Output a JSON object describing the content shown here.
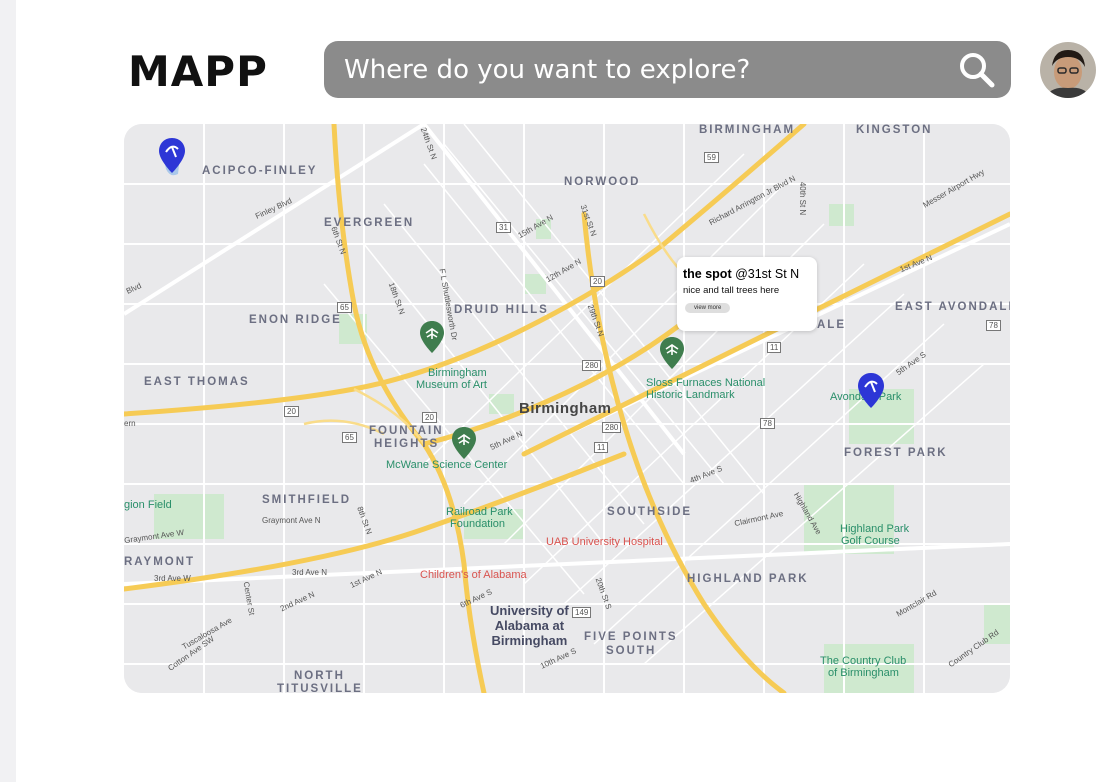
{
  "app": {
    "logo": "MAPP",
    "search": {
      "placeholder": "Where do you want to explore?"
    }
  },
  "map": {
    "city_label": "Birmingham",
    "neighborhoods": [
      "BIRMINGHAM",
      "KINGSTON",
      "ACIPCO-FINLEY",
      "NORWOOD",
      "EVERGREEN",
      "DRUID HILLS",
      "EAST AVONDALE",
      "ENON RIDGE",
      "EAST THOMAS",
      "FOUNTAIN",
      "HEIGHTS",
      "FOREST PARK",
      "SMITHFIELD",
      "SOUTHSIDE",
      "RAYMONT",
      "HIGHLAND PARK",
      "FIVE POINTS",
      "SOUTH",
      "NORTH",
      "TITUSVILLE",
      "ALE"
    ],
    "places": [
      "Birmingham",
      "Museum of Art",
      "Sloss Furnaces National",
      "Historic Landmark",
      "McWane Science Center",
      "Railroad Park",
      "Foundation",
      "UAB University Hospital",
      "Children's of Alabama",
      "Avondale Park",
      "Highland Park",
      "Golf Course",
      "The Country Club",
      "of Birmingham",
      "gion Field"
    ],
    "university": [
      "University of",
      "Alabama at",
      "Birmingham"
    ],
    "streets": [
      "Finley Blvd",
      "24th St N",
      "15th Ave N",
      "12th Ave N",
      "31st St N",
      "Richard Arrington Jr Blvd N",
      "40th St N",
      "Messer Airport Hwy",
      "1st Ave N",
      "5th Ave S",
      "4th Ave S",
      "Clairmont Ave",
      "Highland Ave",
      "Montclair Rd",
      "Country Club Rd",
      "3rd Ave W",
      "3rd Ave N",
      "1st Ave N",
      "2nd Ave N",
      "Center St",
      "Tuscaloosa Ave",
      "Cotton Ave SW",
      "Graymont Ave N",
      "Graymont Ave W",
      "6th St N",
      "8th St N",
      "18th St N",
      "F L Shuttlesworth Dr",
      "29th St N",
      "20th St S",
      "6th Ave S",
      "10th Ave S",
      "5th Ave N",
      "ern",
      "Blvd"
    ],
    "route_shields": [
      "59",
      "31",
      "20",
      "65",
      "280",
      "11",
      "78",
      "149",
      "20",
      "65",
      "78",
      "11",
      "280",
      "20"
    ],
    "popup": {
      "title": "the spot",
      "location": "@31st St N",
      "description": "nice and tall trees here",
      "button_label": "view more"
    },
    "colors": {
      "pin_blue": "#2d36d6",
      "pin_green": "#3f7d4e",
      "highway": "#f5c84c",
      "park": "#c5e8c5",
      "water": "#a8c8ea"
    }
  }
}
